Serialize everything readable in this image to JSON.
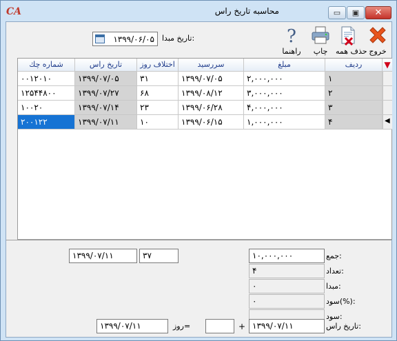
{
  "window": {
    "logo": "CA",
    "title": "محاسبه تاریخ راس",
    "controls": {
      "minimize": "▭",
      "maximize": "▣",
      "close": "✕"
    }
  },
  "toolbar": {
    "exit_label": "خروج",
    "delete_all_label": "حذف همه",
    "print_label": "چاپ",
    "help_label": "راهنما",
    "start_date_label": "تاریخ مبدا:",
    "start_date_value": "۱۳۹۹/۰۶/۰۵"
  },
  "grid": {
    "filter_icon": "▼",
    "columns": [
      "ردیف",
      "مبلغ",
      "سررسید",
      "اختلاف روز",
      "تاریخ راس",
      "شماره چك"
    ],
    "rows": [
      {
        "row": "۱",
        "amount": "۲,۰۰۰,۰۰۰",
        "due": "۱۳۹۹/۰۷/۰۵",
        "diff": "۳۱",
        "head_date": "۱۳۹۹/۰۷/۰۵",
        "check": "۰۰۱۲۰۱۰"
      },
      {
        "row": "۲",
        "amount": "۳,۰۰۰,۰۰۰",
        "due": "۱۳۹۹/۰۸/۱۲",
        "diff": "۶۸",
        "head_date": "۱۳۹۹/۰۷/۲۷",
        "check": "۱۲۵۴۴۸۰۰"
      },
      {
        "row": "۳",
        "amount": "۴,۰۰۰,۰۰۰",
        "due": "۱۳۹۹/۰۶/۲۸",
        "diff": "۲۳",
        "head_date": "۱۳۹۹/۰۷/۱۴",
        "check": "۱۰۰۲۰"
      },
      {
        "row": "۴",
        "amount": "۱,۰۰۰,۰۰۰",
        "due": "۱۳۹۹/۰۶/۱۵",
        "diff": "۱۰",
        "head_date": "۱۳۹۹/۰۷/۱۱",
        "check": "۲۰۰۱۲۲"
      }
    ]
  },
  "summary": {
    "sum_label": "جمع:",
    "sum_value": "۱۰,۰۰۰,۰۰۰",
    "count_label": "تعداد:",
    "count_value": "۴",
    "base_label": "مبدا:",
    "base_value": "۰",
    "profit_pct_label": "سود(%):",
    "profit_pct_value": "۰",
    "profit_label": "سود:",
    "profit_value": "",
    "head_date_label": "تاریخ راس:",
    "head_date_value": "۱۳۹۹/۰۷/۱۱",
    "plus_sign": "+",
    "days_input_value": "",
    "days_label": "روز=",
    "result_date_value": "۱۳۹۹/۰۷/۱۱",
    "avg_days_value": "۳۷",
    "avg_date_value": "۱۳۹۹/۰۷/۱۱"
  }
}
